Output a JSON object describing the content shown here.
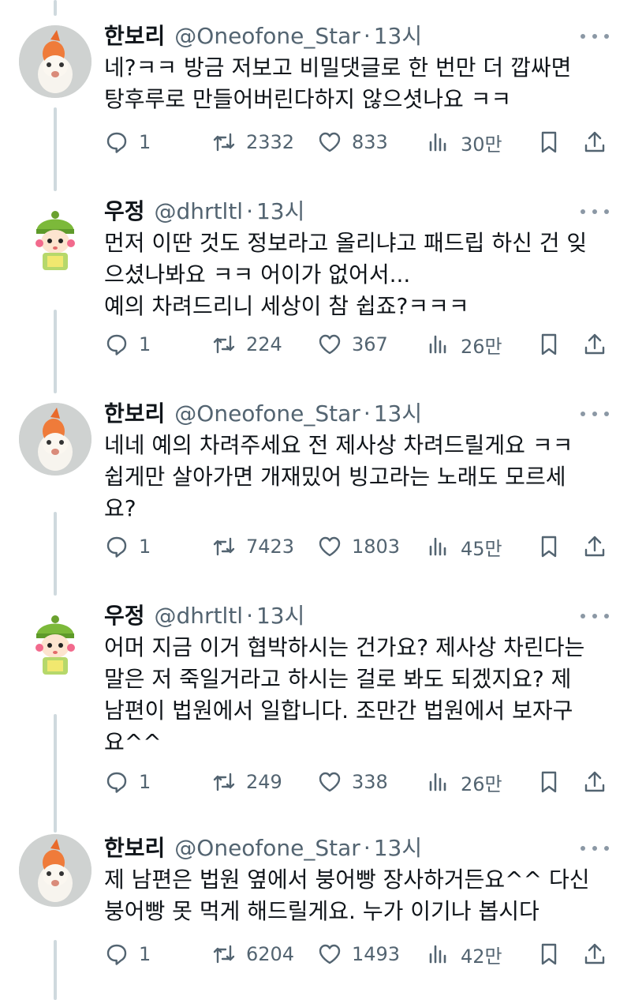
{
  "tweets": [
    {
      "author": "한보리",
      "handle": "@Oneofone_Star",
      "sep": "·",
      "time": "13시",
      "text": "네?ㅋㅋ 방금 저보고 비밀댓글로 한 번만 더 깝싸면\n탕후루로 만들어버린다하지 않으셧나요 ㅋㅋ",
      "replies": "1",
      "retweets": "2332",
      "likes": "833",
      "views": "30만",
      "avatar": "goldfish"
    },
    {
      "author": "우정",
      "handle": "@dhrtltl",
      "sep": "·",
      "time": "13시",
      "text": "먼저 이딴 것도 정보라고 올리냐고 패드립 하신 건 잊\n으셨나봐요 ㅋㅋ 어이가 없어서...\n예의 차려드리니 세상이 참 쉽죠?ㅋㅋㅋ",
      "replies": "1",
      "retweets": "224",
      "likes": "367",
      "views": "26만",
      "avatar": "cartoon-girl"
    },
    {
      "author": "한보리",
      "handle": "@Oneofone_Star",
      "sep": "·",
      "time": "13시",
      "text": "네네 예의 차려주세요 전 제사상 차려드릴게요 ㅋㅋ\n쉽게만 살아가면 개재밌어 빙고라는 노래도 모르세\n요?",
      "replies": "1",
      "retweets": "7423",
      "likes": "1803",
      "views": "45만",
      "avatar": "goldfish"
    },
    {
      "author": "우정",
      "handle": "@dhrtltl",
      "sep": "·",
      "time": "13시",
      "text": "어머 지금 이거 협박하시는 건가요? 제사상 차린다는\n말은 저 죽일거라고 하시는 걸로 봐도 되겠지요? 제\n남편이 법원에서 일합니다. 조만간 법원에서 보자구\n요^^",
      "replies": "1",
      "retweets": "249",
      "likes": "338",
      "views": "26만",
      "avatar": "cartoon-girl"
    },
    {
      "author": "한보리",
      "handle": "@Oneofone_Star",
      "sep": "·",
      "time": "13시",
      "text": "제 남편은 법원 옆에서 붕어빵 장사하거든요^^ 다신\n붕어빵 못 먹게 해드릴게요. 누가 이기나 봅시다",
      "replies": "1",
      "retweets": "6204",
      "likes": "1493",
      "views": "42만",
      "avatar": "goldfish"
    }
  ],
  "colors": {
    "text": "#0f1419",
    "muted": "#536471",
    "thread": "#cfd9de"
  }
}
